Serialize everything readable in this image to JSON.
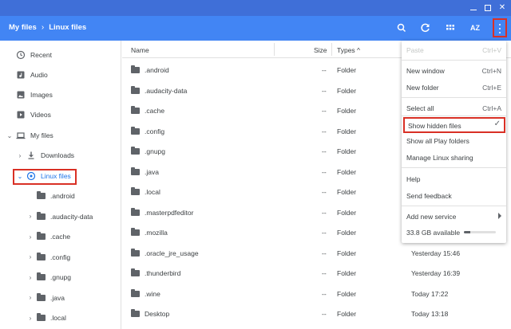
{
  "breadcrumb": {
    "root": "My files",
    "current": "Linux files"
  },
  "toolbar": {
    "sort_label": "AZ"
  },
  "sidebar": {
    "recent": "Recent",
    "audio": "Audio",
    "images": "Images",
    "videos": "Videos",
    "my_files": "My files",
    "downloads": "Downloads",
    "linux_files": "Linux files",
    "tree": [
      ".android",
      ".audacity-data",
      ".cache",
      ".config",
      ".gnupg",
      ".java",
      ".local"
    ]
  },
  "columns": {
    "name": "Name",
    "size": "Size",
    "type": "Types ^"
  },
  "files": [
    {
      "name": ".android",
      "size": "--",
      "type": "Folder",
      "date": ""
    },
    {
      "name": ".audacity-data",
      "size": "--",
      "type": "Folder",
      "date": ""
    },
    {
      "name": ".cache",
      "size": "--",
      "type": "Folder",
      "date": ""
    },
    {
      "name": ".config",
      "size": "--",
      "type": "Folder",
      "date": ""
    },
    {
      "name": ".gnupg",
      "size": "--",
      "type": "Folder",
      "date": ""
    },
    {
      "name": ".java",
      "size": "--",
      "type": "Folder",
      "date": ""
    },
    {
      "name": ".local",
      "size": "--",
      "type": "Folder",
      "date": ""
    },
    {
      "name": ".masterpdfeditor",
      "size": "--",
      "type": "Folder",
      "date": ""
    },
    {
      "name": ".mozilla",
      "size": "--",
      "type": "Folder",
      "date": ""
    },
    {
      "name": ".oracle_jre_usage",
      "size": "--",
      "type": "Folder",
      "date": "Yesterday 15:46"
    },
    {
      "name": ".thunderbird",
      "size": "--",
      "type": "Folder",
      "date": "Yesterday 16:39"
    },
    {
      "name": ".wine",
      "size": "--",
      "type": "Folder",
      "date": "Today 17:22"
    },
    {
      "name": "Desktop",
      "size": "--",
      "type": "Folder",
      "date": "Today 13:18"
    }
  ],
  "menu": {
    "paste": {
      "label": "Paste",
      "shortcut": "Ctrl+V"
    },
    "new_window": {
      "label": "New window",
      "shortcut": "Ctrl+N"
    },
    "new_folder": {
      "label": "New folder",
      "shortcut": "Ctrl+E"
    },
    "select_all": {
      "label": "Select all",
      "shortcut": "Ctrl+A"
    },
    "show_hidden": {
      "label": "Show hidden files",
      "check": "✓"
    },
    "show_play": {
      "label": "Show all Play folders"
    },
    "manage_linux": {
      "label": "Manage Linux sharing"
    },
    "help": {
      "label": "Help"
    },
    "feedback": {
      "label": "Send feedback"
    },
    "add_service": {
      "label": "Add new service"
    },
    "storage": {
      "label": "33.8 GB available",
      "used_fraction": 0.2
    }
  }
}
